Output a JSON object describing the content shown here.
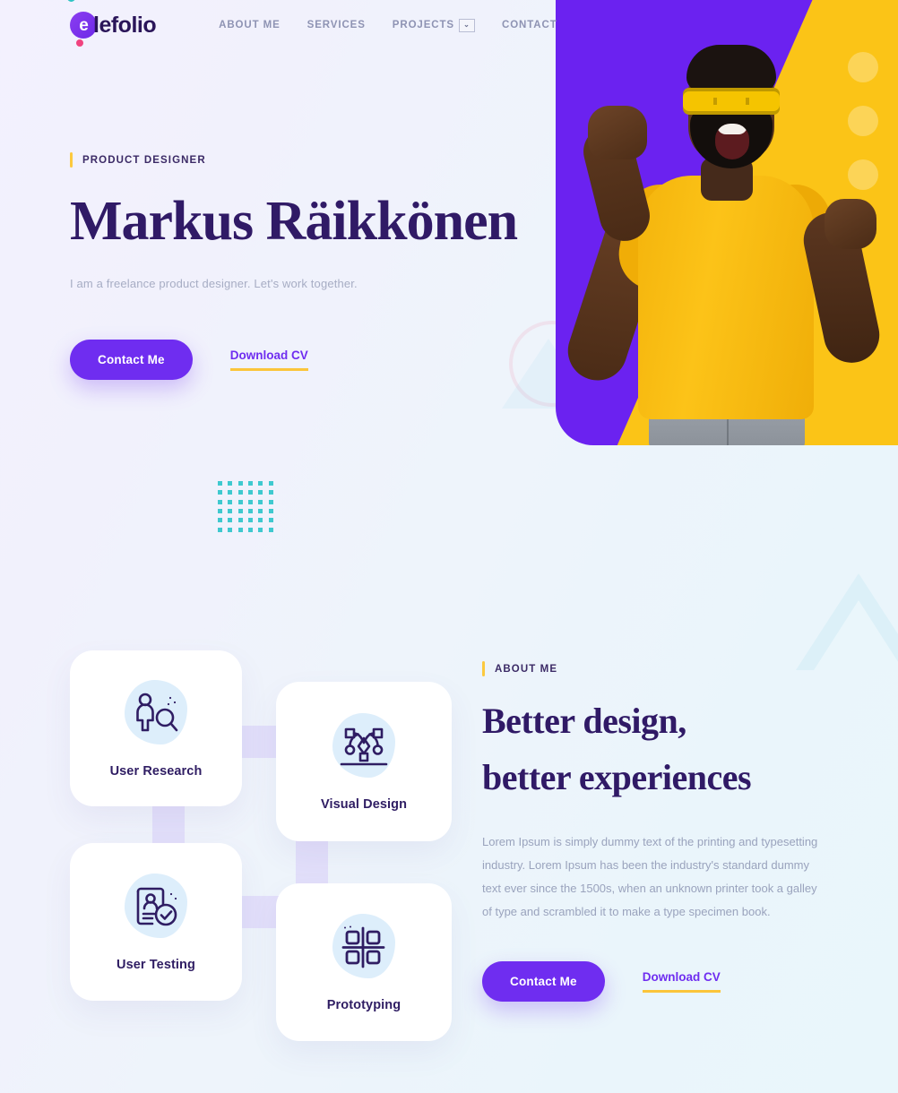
{
  "brand": {
    "logo_letter": "e",
    "name": "lefolio",
    "full_name": "elefolio",
    "accent_purple": "#6f2df0",
    "accent_yellow": "#fbc53a",
    "accent_teal": "#2ec4c4",
    "accent_pink": "#f0437f",
    "heading_color": "#301a66"
  },
  "nav": {
    "items": [
      {
        "label": "ABOUT ME",
        "has_dropdown": false
      },
      {
        "label": "SERVICES",
        "has_dropdown": false
      },
      {
        "label": "PROJECTS",
        "has_dropdown": true,
        "caret": "⌄"
      },
      {
        "label": "CONTACT",
        "has_dropdown": false
      }
    ]
  },
  "hero": {
    "eyebrow": "PRODUCT DESIGNER",
    "title": "Markus Räikkönen",
    "subtitle": "I am a freelance product designer. Let's work together.",
    "primary_button": "Contact Me",
    "secondary_link": "Download CV",
    "image_alt": "celebrating-man-photo"
  },
  "services": {
    "cards": [
      {
        "label": "User Research",
        "icon": "person-search-icon"
      },
      {
        "label": "Visual Design",
        "icon": "pen-tool-icon"
      },
      {
        "label": "User Testing",
        "icon": "document-check-icon"
      },
      {
        "label": "Prototyping",
        "icon": "grid-cross-icon"
      }
    ]
  },
  "about": {
    "eyebrow": "ABOUT ME",
    "title_line1": "Better design,",
    "title_line2": "better experiences",
    "paragraph": "Lorem Ipsum is simply dummy text of the printing and typesetting industry. Lorem Ipsum has been the industry's standard dummy text ever since the 1500s, when an unknown printer took a galley of type and scrambled it to make a type specimen book.",
    "primary_button": "Contact Me",
    "secondary_link": "Download CV"
  }
}
